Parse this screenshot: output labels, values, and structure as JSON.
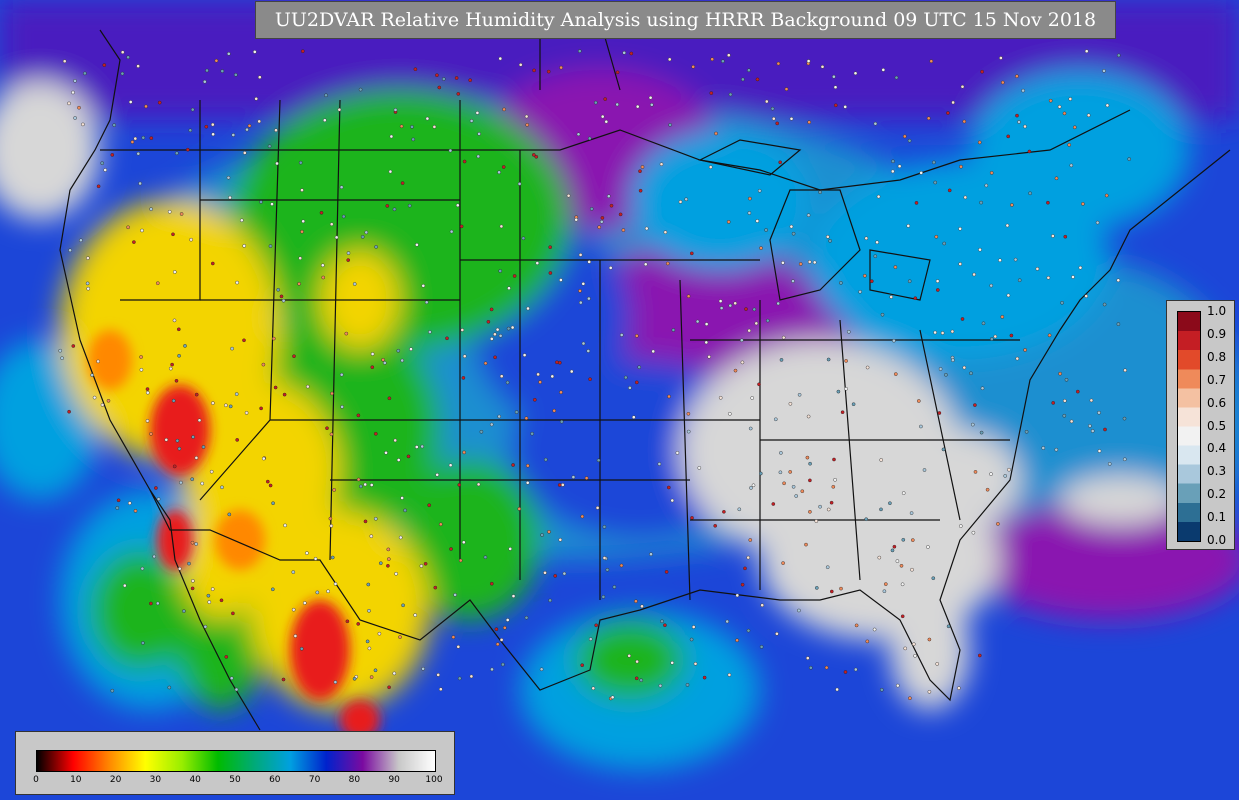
{
  "title": "UU2DVAR Relative Humidity Analysis using HRRR Background 09 UTC 15 Nov 2018",
  "colors": {
    "ocean": "#1c46d8",
    "land_moist": "#1a8fd0",
    "very_moist": "#8a12b0",
    "near_saturated": "#d7d7d7",
    "moderate": "#1fb41f",
    "dry": "#f3d400",
    "very_dry": "#e81a1a",
    "state_lines": "#111111"
  },
  "rh_colorbar": {
    "label_values": [
      "0",
      "10",
      "20",
      "30",
      "40",
      "50",
      "60",
      "70",
      "80",
      "90",
      "100"
    ],
    "stops": [
      "#000000",
      "#ff0000",
      "#ff8800",
      "#ffff00",
      "#99ee00",
      "#00bb00",
      "#00aa77",
      "#00a0e0",
      "#0022cc",
      "#7a0aa0",
      "#c8c8c8",
      "#ffffff"
    ]
  },
  "increment_colorbar": {
    "label_values": [
      "1.0",
      "0.9",
      "0.8",
      "0.7",
      "0.6",
      "0.5",
      "0.4",
      "0.3",
      "0.2",
      "0.1",
      "0.0"
    ],
    "stops": [
      "#8b0a1a",
      "#c41e24",
      "#e24a2a",
      "#ef8a5a",
      "#f4c1a2",
      "#f6e3d8",
      "#f2f2f2",
      "#d9e7f0",
      "#a9c8dc",
      "#69a0b8",
      "#2d6f94",
      "#0a3a6e"
    ]
  }
}
